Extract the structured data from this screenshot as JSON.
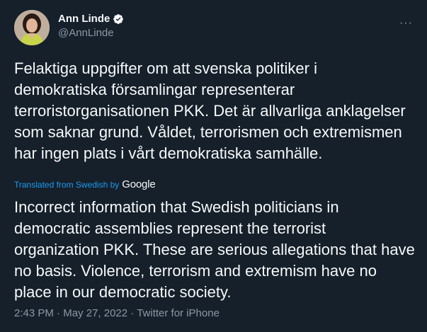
{
  "author": {
    "display_name": "Ann Linde",
    "handle": "@AnnLinde",
    "verified_icon": "verified-badge-icon"
  },
  "more_label": "···",
  "tweet": {
    "original_text": "Felaktiga uppgifter om att svenska politiker i demokratiska församlingar representerar terroristorganisationen PKK. Det är allvarliga anklagelser som saknar grund. Våldet, terrorismen och extremismen har ingen plats i vårt demokratiska samhälle.",
    "translated_label": "Translated from Swedish by",
    "translator": "Google",
    "translated_text": "Incorrect information that Swedish politicians in democratic assemblies represent the terrorist organization PKK. These are serious allegations that have no basis. Violence, terrorism and extremism have no place in our democratic society."
  },
  "meta": {
    "time": "2:43 PM",
    "separator": " · ",
    "date": "May 27, 2022",
    "source": "Twitter for iPhone"
  },
  "colors": {
    "background": "#15202b",
    "text": "#f7f9f9",
    "secondary": "#8b98a5",
    "link": "#1d9bf0"
  }
}
